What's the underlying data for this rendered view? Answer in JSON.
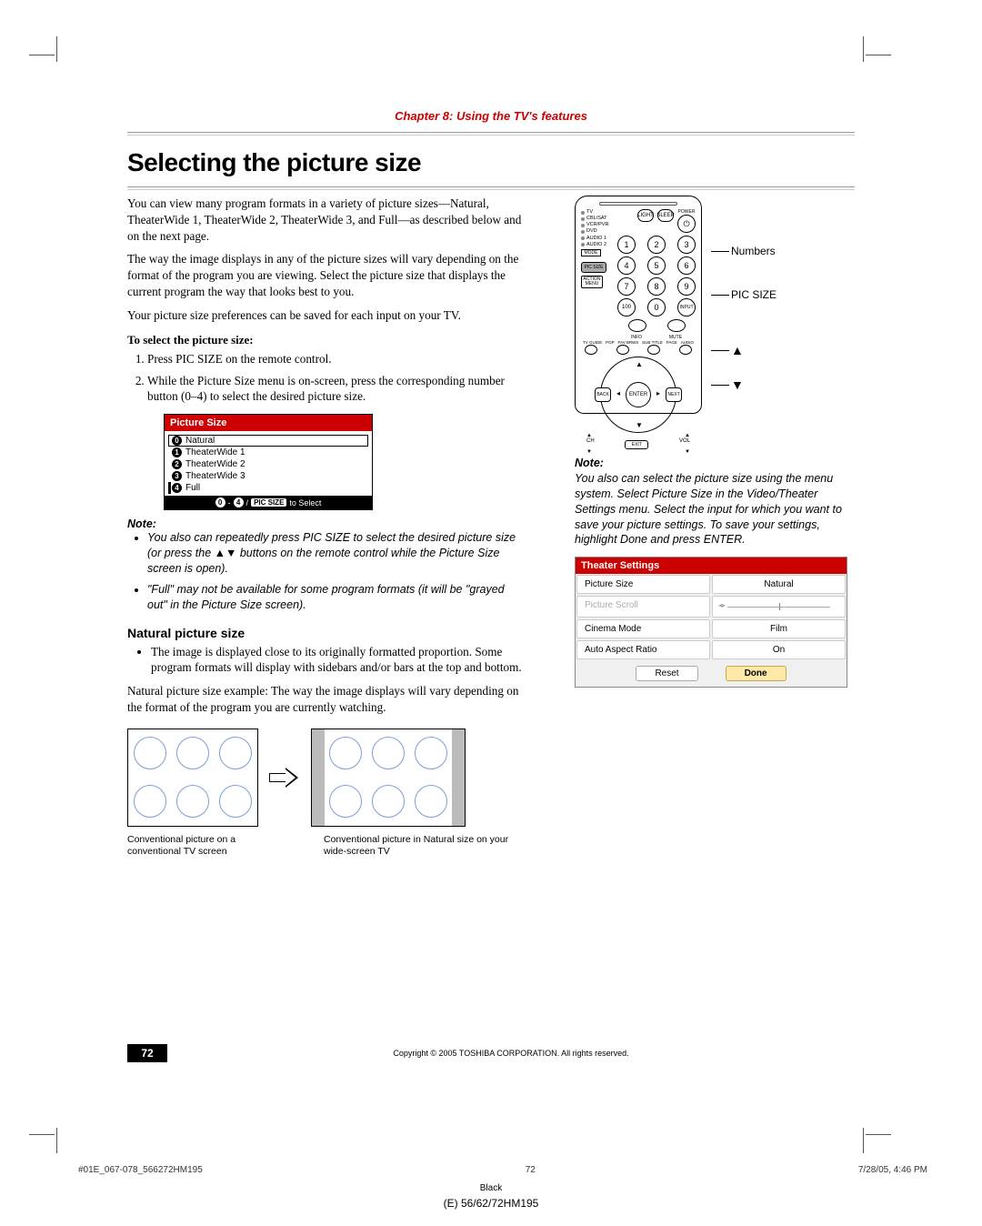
{
  "header": {
    "chapter": "Chapter 8: Using the TV's features"
  },
  "title": "Selecting the picture size",
  "intro": [
    "You can view many program formats in a variety of picture sizes—Natural, TheaterWide 1, TheaterWide 2, TheaterWide 3, and Full—as described below and on the next page.",
    "The way the image displays in any of the picture sizes will vary depending on the format of the program you are viewing. Select the picture size that displays the current program the way that looks best to you.",
    "Your picture size preferences can be saved for each input on your TV."
  ],
  "instructions": {
    "heading": "To select the picture size:",
    "steps": [
      "Press PIC SIZE on the remote control.",
      "While the Picture Size menu is on-screen, press the corresponding number button (0–4) to select the desired picture size."
    ]
  },
  "osd": {
    "title": "Picture Size",
    "items": [
      {
        "num": "0",
        "label": "Natural"
      },
      {
        "num": "1",
        "label": "TheaterWide 1"
      },
      {
        "num": "2",
        "label": "TheaterWide 2"
      },
      {
        "num": "3",
        "label": "TheaterWide 3"
      },
      {
        "num": "4",
        "label": "Full"
      }
    ],
    "footer_prefix": "0",
    "footer_dash": " - ",
    "footer_suffix": "4",
    "footer_slash": " / ",
    "footer_pill": "PIC SIZE",
    "footer_end": " to Select"
  },
  "note_left": {
    "heading": "Note:",
    "items": [
      "You also can repeatedly press PIC SIZE to select the desired picture size (or press the ▲▼ buttons on the remote control while the Picture Size screen is open).",
      "\"Full\" may not be available for some program formats (it will be \"grayed out\" in the Picture Size screen)."
    ]
  },
  "natural": {
    "heading": "Natural picture size",
    "bullet": "The image is displayed close to its originally formatted proportion. Some program formats will display with sidebars and/or bars at the top and bottom."
  },
  "example_text": "Natural picture size example: The way the image displays will vary depending on the format of the program you are currently watching.",
  "captions": {
    "left": "Conventional picture on a conventional TV screen",
    "right": "Conventional picture in Natural size on your wide-screen TV"
  },
  "remote": {
    "modes": [
      "TV",
      "CBL/SAT",
      "VCR/PVR",
      "DVD",
      "AUDIO 1",
      "AUDIO 2"
    ],
    "mode_box": "MODE",
    "top_small": [
      "LIGHT",
      "SLEEP"
    ],
    "power_label": "POWER",
    "numbers": [
      "1",
      "2",
      "3",
      "4",
      "5",
      "6",
      "7",
      "8",
      "9",
      "100",
      "0",
      "INPUT"
    ],
    "picsize": "PIC SIZE",
    "action": "ACTION\nMENU",
    "info": "INFO",
    "mute": "MUTE",
    "fav_arc": [
      "TV GUIDE",
      "POP",
      "FAV BRWS",
      "SUB TITLE",
      "PAGE",
      "AUDIO"
    ],
    "enter": "ENTER",
    "back": "BACK",
    "next": "NEXT",
    "ch": "CH",
    "vol": "VOL",
    "exit": "EXIT",
    "labels": {
      "numbers": "Numbers",
      "picsize": "PIC SIZE",
      "up": "▲",
      "down": "▼"
    }
  },
  "note_right": {
    "heading": "Note:",
    "text": "You also can select the picture size using the menu system. Select Picture Size in the Video/Theater Settings menu. Select the input for which you want to save your picture settings.  To save your settings, highlight Done and press ENTER."
  },
  "theater_settings": {
    "title": "Theater Settings",
    "rows": [
      {
        "label": "Picture Size",
        "value": "Natural",
        "dim": false
      },
      {
        "label": "Picture Scroll",
        "slider": true,
        "dim": true
      },
      {
        "label": "Cinema Mode",
        "value": "Film",
        "dim": false
      },
      {
        "label": "Auto Aspect Ratio",
        "value": "On",
        "dim": false
      }
    ],
    "buttons": {
      "reset": "Reset",
      "done": "Done"
    }
  },
  "footer": {
    "page_number": "72",
    "copyright": "Copyright © 2005 TOSHIBA CORPORATION. All rights reserved."
  },
  "meta": {
    "left": "#01E_067-078_566272HM195",
    "mid": "72",
    "right": "7/28/05, 4:46 PM",
    "black": "Black",
    "doc_id": "(E) 56/62/72HM195"
  }
}
